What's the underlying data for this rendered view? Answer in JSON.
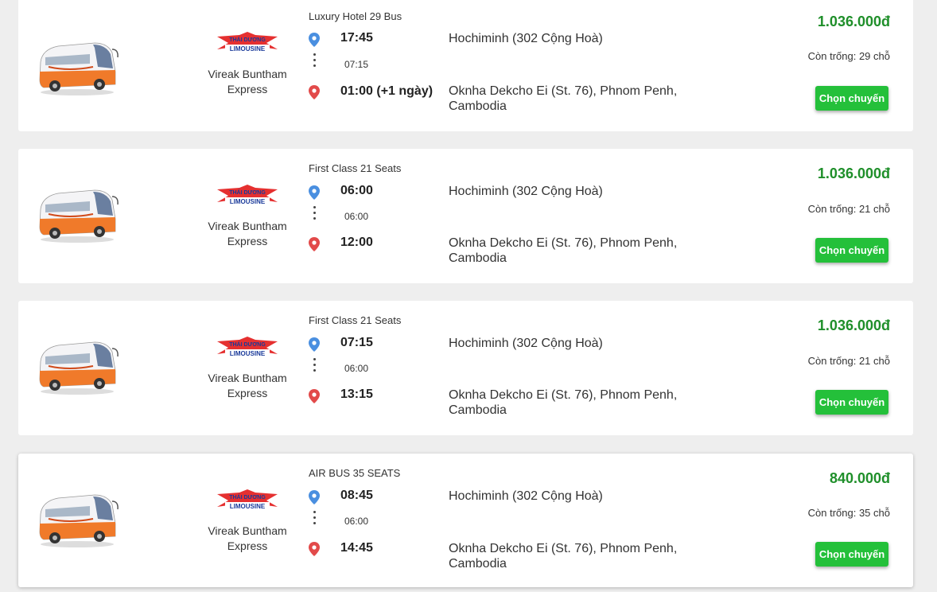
{
  "colors": {
    "price": "#1f8f2a",
    "button": "#24c03a",
    "pin_departure": "#4a8fe0",
    "pin_arrival": "#e24a4a"
  },
  "trips": [
    {
      "bus_type": "Luxury Hotel 29 Bus",
      "operator_name": "Vireak Buntham Express",
      "operator_logo_text": "THÁI DƯƠNG LIMOUSINE",
      "depart_time": "17:45",
      "duration": "07:15",
      "arrive_time": "01:00 (+1 ngày)",
      "origin": "Hochiminh (302 Cộng Hoà)",
      "destination": "Oknha Dekcho Ei (St. 76), Phnom Penh, Cambodia",
      "price": "1.036.000đ",
      "seats": "Còn trống: 29 chỗ",
      "button": "Chọn chuyến"
    },
    {
      "bus_type": "First Class 21 Seats",
      "operator_name": "Vireak Buntham Express",
      "operator_logo_text": "THÁI DƯƠNG LIMOUSINE",
      "depart_time": "06:00",
      "duration": "06:00",
      "arrive_time": "12:00",
      "origin": "Hochiminh (302 Cộng Hoà)",
      "destination": "Oknha Dekcho Ei (St. 76), Phnom Penh, Cambodia",
      "price": "1.036.000đ",
      "seats": "Còn trống: 21 chỗ",
      "button": "Chọn chuyến"
    },
    {
      "bus_type": "First Class 21 Seats",
      "operator_name": "Vireak Buntham Express",
      "operator_logo_text": "THÁI DƯƠNG LIMOUSINE",
      "depart_time": "07:15",
      "duration": "06:00",
      "arrive_time": "13:15",
      "origin": "Hochiminh (302 Cộng Hoà)",
      "destination": "Oknha Dekcho Ei (St. 76), Phnom Penh, Cambodia",
      "price": "1.036.000đ",
      "seats": "Còn trống: 21 chỗ",
      "button": "Chọn chuyến"
    },
    {
      "bus_type": "AIR BUS 35 SEATS",
      "operator_name": "Vireak Buntham Express",
      "operator_logo_text": "THÁI DƯƠNG LIMOUSINE",
      "depart_time": "08:45",
      "duration": "06:00",
      "arrive_time": "14:45",
      "origin": "Hochiminh (302 Cộng Hoà)",
      "destination": "Oknha Dekcho Ei (St. 76), Phnom Penh, Cambodia",
      "price": "840.000đ",
      "seats": "Còn trống: 35 chỗ",
      "button": "Chọn chuyến"
    }
  ]
}
